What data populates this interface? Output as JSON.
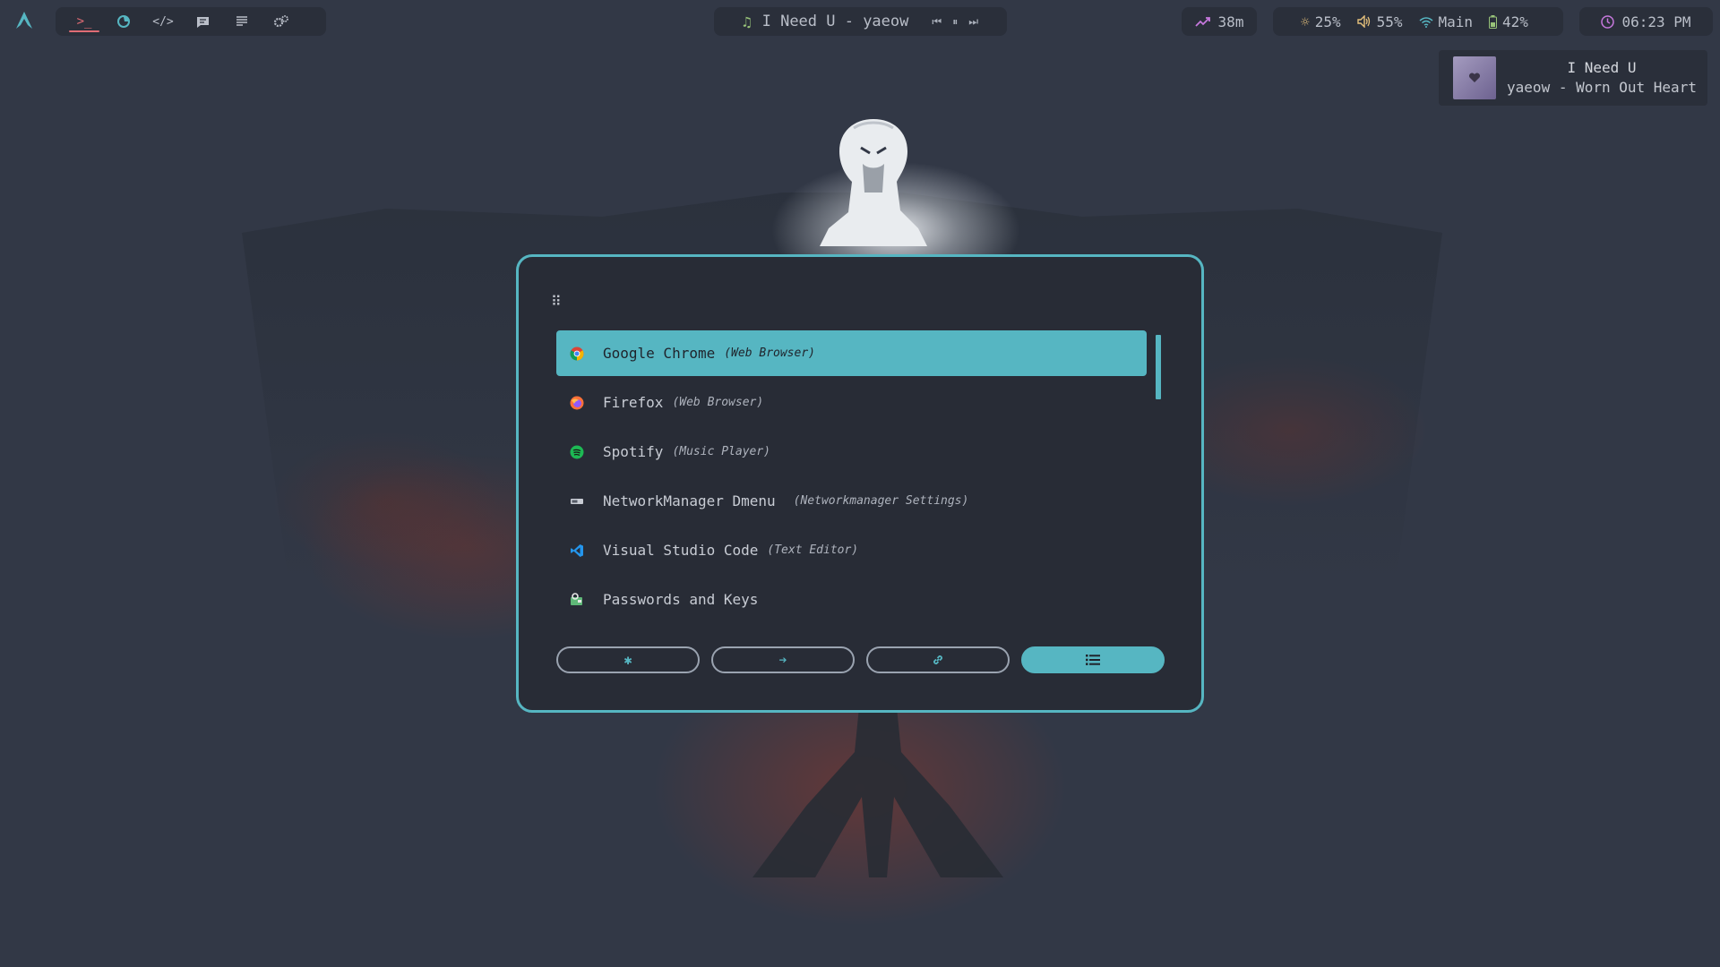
{
  "topbar": {
    "launcher_icon": "arch-logo-icon",
    "workspaces": [
      {
        "icon": "terminal-icon",
        "active": true
      },
      {
        "icon": "firefox-icon",
        "active": false
      },
      {
        "icon": "code-icon",
        "active": false
      },
      {
        "icon": "chat-icon",
        "active": false
      },
      {
        "icon": "document-icon",
        "active": false
      },
      {
        "icon": "settings-icon",
        "active": false
      }
    ],
    "media": {
      "icon": "music-note-icon",
      "title": "I Need U - yaeow",
      "controls": [
        "previous-icon",
        "pause-icon",
        "next-icon"
      ]
    },
    "uptime": {
      "icon": "trending-up-icon",
      "value": "38m"
    },
    "status": {
      "brightness": {
        "icon": "sun-icon",
        "value": "25%"
      },
      "volume": {
        "icon": "speaker-icon",
        "value": "55%"
      },
      "wifi": {
        "icon": "wifi-icon",
        "value": "Main"
      },
      "battery": {
        "icon": "battery-icon",
        "value": "42%"
      }
    },
    "clock": {
      "icon": "clock-icon",
      "value": "06:23 PM"
    }
  },
  "notification": {
    "title": "I Need U",
    "body": "yaeow - Worn Out Heart"
  },
  "launcher": {
    "prompt_icon": "grid-dots-icon",
    "items": [
      {
        "name": "Google Chrome",
        "desc": "(Web Browser)",
        "icon": "chrome-icon",
        "selected": true
      },
      {
        "name": "Firefox",
        "desc": "(Web Browser)",
        "icon": "firefox-icon",
        "selected": false
      },
      {
        "name": "Spotify",
        "desc": "(Music Player)",
        "icon": "spotify-icon",
        "selected": false
      },
      {
        "name": "NetworkManager Dmenu",
        "desc": "(Networkmanager Settings)",
        "icon": "network-icon",
        "selected": false
      },
      {
        "name": "Visual Studio Code",
        "desc": "(Text Editor)",
        "icon": "vscode-icon",
        "selected": false
      },
      {
        "name": "Passwords and Keys",
        "desc": "",
        "icon": "keyring-icon",
        "selected": false
      }
    ],
    "modes": [
      {
        "icon": "asterisk-icon",
        "glyph": "✱",
        "active": false
      },
      {
        "icon": "arrow-right-icon",
        "glyph": "➔",
        "active": false
      },
      {
        "icon": "link-icon",
        "glyph": "🔗",
        "active": false
      },
      {
        "icon": "list-icon",
        "glyph": "☰",
        "active": true
      }
    ]
  },
  "colors": {
    "accent": "#56b6c2",
    "background": "#323846",
    "panel": "#282c36",
    "active_underline": "#e06c75"
  }
}
